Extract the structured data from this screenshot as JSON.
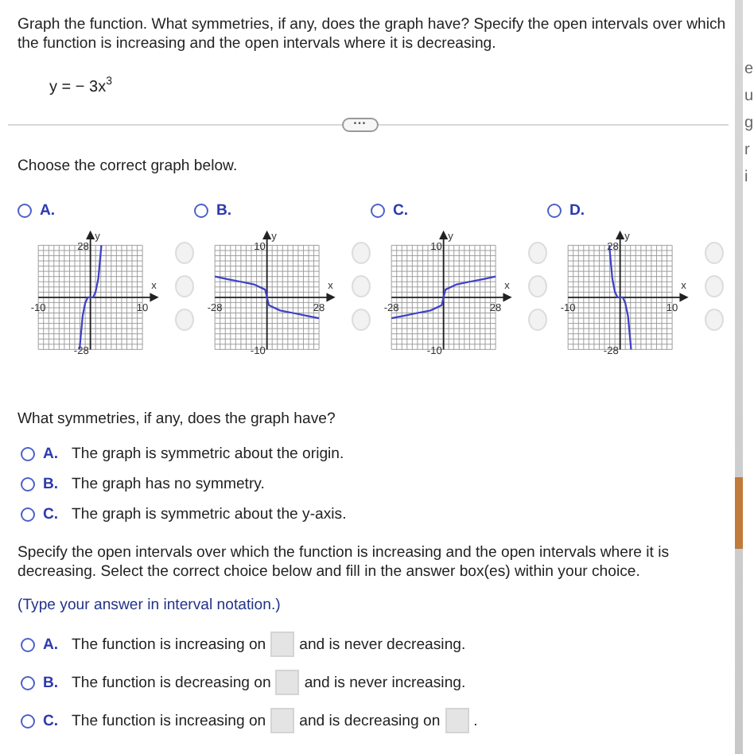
{
  "prompt": "Graph the function. What symmetries, if any, does the graph have? Specify the open intervals over which the function is increasing and the open intervals where it is decreasing.",
  "equation": "y = − 3x$^{3}$",
  "divider_button": "•••",
  "graph_prompt": "Choose the correct graph below.",
  "graph_choices": [
    {
      "letter": "A.",
      "selected": false,
      "chart_data": {
        "type": "line",
        "xlabel": "x",
        "ylabel": "y",
        "x": [
          -2.1,
          -1.5,
          -1,
          -0.5,
          0,
          0.5,
          1,
          1.5,
          2.1
        ],
        "series": [
          {
            "color": "#4040c8",
            "values": [
              -28,
              -10,
              -3,
              0,
              0,
              0,
              3,
              10,
              28
            ]
          }
        ],
        "xlim": [
          -10,
          10
        ],
        "ylim": [
          -28,
          28
        ],
        "xticks": [
          -10,
          10
        ],
        "yticks": [
          -28,
          28
        ]
      }
    },
    {
      "letter": "B.",
      "selected": false,
      "chart_data": {
        "type": "line",
        "xlabel": "x",
        "ylabel": "y",
        "x": [
          -28,
          -21,
          -14,
          -7,
          -1,
          0,
          1,
          7,
          14,
          21,
          28
        ],
        "series": [
          {
            "color": "#4040c8",
            "values": [
              4,
              3.5,
              3,
              2.5,
              1.5,
              0,
              -1.5,
              -2.5,
              -3,
              -3.5,
              -4
            ]
          }
        ],
        "xlim": [
          -28,
          28
        ],
        "ylim": [
          -10,
          10
        ],
        "xticks": [
          -28,
          28
        ],
        "yticks": [
          -10,
          10
        ]
      }
    },
    {
      "letter": "C.",
      "selected": false,
      "chart_data": {
        "type": "line",
        "xlabel": "x",
        "ylabel": "y",
        "x": [
          -28,
          -21,
          -14,
          -7,
          -1,
          0,
          1,
          7,
          14,
          21,
          28
        ],
        "series": [
          {
            "color": "#4040c8",
            "values": [
              -4,
              -3.5,
              -3,
              -2.5,
              -1.5,
              0,
              1.5,
              2.5,
              3,
              3.5,
              4
            ]
          }
        ],
        "xlim": [
          -28,
          28
        ],
        "ylim": [
          -10,
          10
        ],
        "xticks": [
          -28,
          28
        ],
        "yticks": [
          -10,
          10
        ]
      }
    },
    {
      "letter": "D.",
      "selected": false,
      "chart_data": {
        "type": "line",
        "xlabel": "x",
        "ylabel": "y",
        "x": [
          -2.1,
          -1.5,
          -1,
          -0.5,
          0,
          0.5,
          1,
          1.5,
          2.1
        ],
        "series": [
          {
            "color": "#4040c8",
            "values": [
              28,
              10,
              3,
              0,
              0,
              0,
              -3,
              -10,
              -28
            ]
          }
        ],
        "xlim": [
          -10,
          10
        ],
        "ylim": [
          -28,
          28
        ],
        "xticks": [
          -10,
          10
        ],
        "yticks": [
          -28,
          28
        ]
      }
    }
  ],
  "symmetry_prompt": "What symmetries, if any, does the graph have?",
  "symmetry_choices": [
    {
      "letter": "A.",
      "text": "The graph is symmetric about the origin.",
      "selected": false
    },
    {
      "letter": "B.",
      "text": "The graph has no symmetry.",
      "selected": false
    },
    {
      "letter": "C.",
      "text": "The graph is symmetric about the y-axis.",
      "selected": false
    }
  ],
  "interval_prompt": "Specify the open intervals over which the function is increasing and the open intervals where it is decreasing. Select the correct choice below and fill in the answer box(es) within your choice.",
  "interval_hint": "(Type your answer in interval notation.)",
  "interval_choices": [
    {
      "letter": "A.",
      "selected": false,
      "parts": [
        {
          "kind": "text",
          "text": "The function is increasing on"
        },
        {
          "kind": "box"
        },
        {
          "kind": "text",
          "text": "and is never decreasing."
        }
      ]
    },
    {
      "letter": "B.",
      "selected": false,
      "parts": [
        {
          "kind": "text",
          "text": "The function is decreasing on"
        },
        {
          "kind": "box"
        },
        {
          "kind": "text",
          "text": "and is never increasing."
        }
      ]
    },
    {
      "letter": "C.",
      "selected": false,
      "parts": [
        {
          "kind": "text",
          "text": "The function is increasing on"
        },
        {
          "kind": "box"
        },
        {
          "kind": "text",
          "text": "and is decreasing on"
        },
        {
          "kind": "box"
        },
        {
          "kind": "text",
          "text": "."
        }
      ]
    }
  ],
  "side_fragments": [
    "e",
    "u",
    "g",
    "r",
    "i"
  ]
}
